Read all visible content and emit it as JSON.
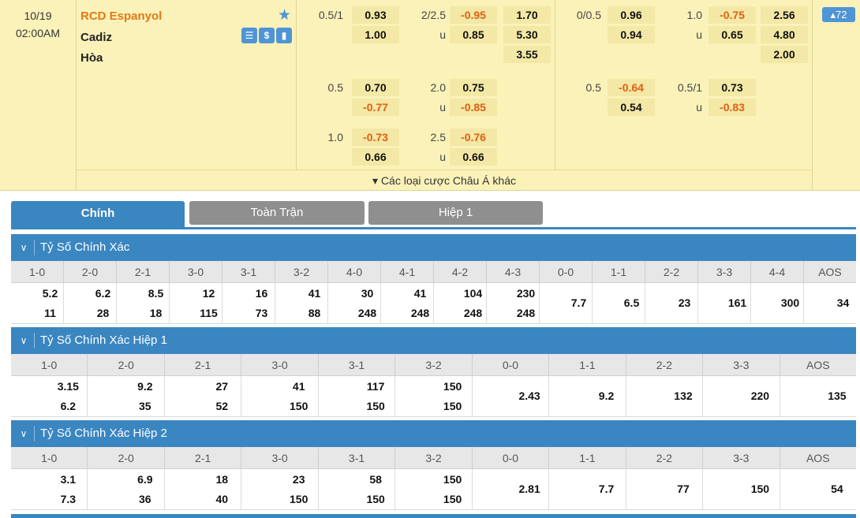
{
  "match": {
    "date": "10/19",
    "time": "02:00AM",
    "home": "RCD Espanyol",
    "away": "Cadiz",
    "draw": "Hòa",
    "star_icon": "star-icon",
    "icons": [
      {
        "name": "lineup-icon",
        "glyph": "☰"
      },
      {
        "name": "odds-icon",
        "glyph": "$"
      },
      {
        "name": "stats-icon",
        "glyph": "▮"
      }
    ],
    "more_label": "▾ Các loại cược Châu Á khác",
    "badge": "▴72",
    "full_time": {
      "row1": {
        "hdp_line": "0.5/1",
        "hdp_home": "0.93",
        "hdp_away": "1.00",
        "ou_line": "2/2.5",
        "ou_over": "-0.95",
        "ou_under_label": "u",
        "ou_under": "0.85",
        "x1": "1.70",
        "x2": "5.30",
        "x3": "3.55"
      },
      "row2": {
        "hdp_line": "0.5",
        "hdp_home": "0.70",
        "hdp_away": "-0.77",
        "ou_line": "2.0",
        "ou_over": "0.75",
        "ou_under_label": "u",
        "ou_under": "-0.85"
      },
      "row3": {
        "hdp_line": "1.0",
        "hdp_home": "-0.73",
        "hdp_away": "0.66",
        "ou_line": "2.5",
        "ou_over": "-0.76",
        "ou_under_label": "u",
        "ou_under": "0.66"
      }
    },
    "first_half": {
      "row1": {
        "hdp_line": "0/0.5",
        "hdp_home": "0.96",
        "hdp_away": "0.94",
        "ou_line": "1.0",
        "ou_over": "-0.75",
        "ou_under_label": "u",
        "ou_under": "0.65",
        "x1": "2.56",
        "x2": "4.80",
        "x3": "2.00"
      },
      "row2": {
        "hdp_line": "0.5",
        "hdp_home": "-0.64",
        "hdp_away": "0.54",
        "ou_line": "0.5/1",
        "ou_over": "0.73",
        "ou_under_label": "u",
        "ou_under": "-0.83"
      }
    }
  },
  "tabs": [
    "Chính",
    "Toàn Trận",
    "Hiệp 1"
  ],
  "sections": [
    {
      "title": "Tỷ Số Chính Xác",
      "headers": [
        "1-0",
        "2-0",
        "2-1",
        "3-0",
        "3-1",
        "3-2",
        "4-0",
        "4-1",
        "4-2",
        "4-3",
        "0-0",
        "1-1",
        "2-2",
        "3-3",
        "4-4",
        "AOS"
      ],
      "top": [
        "5.2",
        "6.2",
        "8.5",
        "12",
        "16",
        "41",
        "30",
        "41",
        "104",
        "230",
        "",
        "",
        "",
        "",
        "",
        ""
      ],
      "bottom": [
        "11",
        "28",
        "18",
        "115",
        "73",
        "88",
        "248",
        "248",
        "248",
        "248",
        "",
        "",
        "",
        "",
        "",
        ""
      ],
      "single": [
        "",
        "",
        "",
        "",
        "",
        "",
        "",
        "",
        "",
        "",
        "7.7",
        "6.5",
        "23",
        "161",
        "300",
        "34"
      ]
    },
    {
      "title": "Tỷ Số Chính Xác Hiệp 1",
      "headers": [
        "1-0",
        "2-0",
        "2-1",
        "3-0",
        "3-1",
        "3-2",
        "0-0",
        "1-1",
        "2-2",
        "3-3",
        "AOS"
      ],
      "top": [
        "3.15",
        "9.2",
        "27",
        "41",
        "117",
        "150",
        "",
        "",
        "",
        "",
        ""
      ],
      "bottom": [
        "6.2",
        "35",
        "52",
        "150",
        "150",
        "150",
        "",
        "",
        "",
        "",
        ""
      ],
      "single": [
        "",
        "",
        "",
        "",
        "",
        "",
        "2.43",
        "9.2",
        "132",
        "220",
        "135"
      ]
    },
    {
      "title": "Tỷ Số Chính Xác Hiệp 2",
      "headers": [
        "1-0",
        "2-0",
        "2-1",
        "3-0",
        "3-1",
        "3-2",
        "0-0",
        "1-1",
        "2-2",
        "3-3",
        "AOS"
      ],
      "top": [
        "3.1",
        "6.9",
        "18",
        "23",
        "58",
        "150",
        "",
        "",
        "",
        "",
        ""
      ],
      "bottom": [
        "7.3",
        "36",
        "40",
        "150",
        "150",
        "150",
        "",
        "",
        "",
        "",
        ""
      ],
      "single": [
        "",
        "",
        "",
        "",
        "",
        "",
        "2.81",
        "7.7",
        "77",
        "150",
        "54"
      ]
    }
  ]
}
